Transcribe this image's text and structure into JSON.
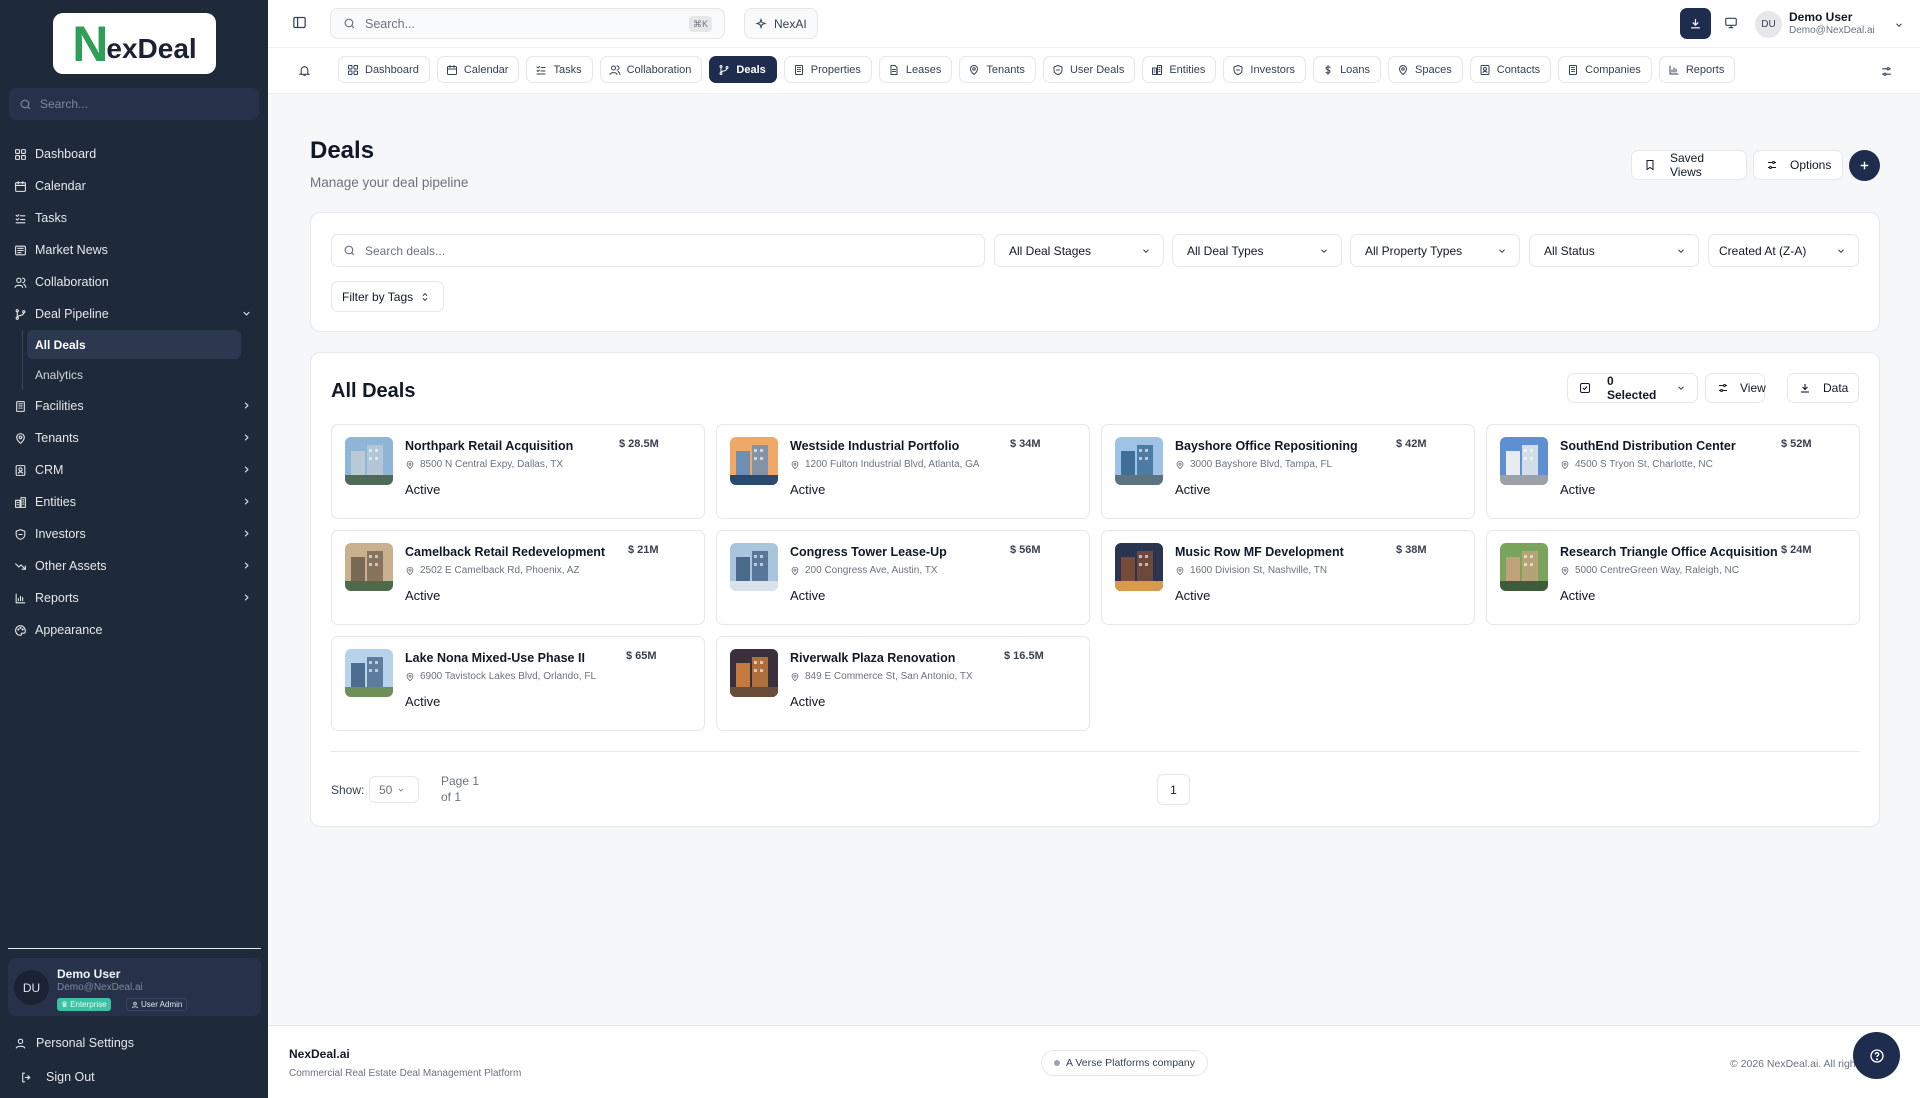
{
  "brand": {
    "logo_n": "N",
    "logo_rest": "exDeal"
  },
  "sidebar": {
    "search_placeholder": "Search...",
    "items": [
      {
        "label": "Dashboard",
        "icon": "dashboard-icon"
      },
      {
        "label": "Calendar",
        "icon": "calendar-icon"
      },
      {
        "label": "Tasks",
        "icon": "tasks-icon"
      },
      {
        "label": "Market News",
        "icon": "news-icon"
      },
      {
        "label": "Collaboration",
        "icon": "users-icon"
      },
      {
        "label": "Deal Pipeline",
        "icon": "pipeline-icon",
        "expanded": true
      },
      {
        "label": "Facilities",
        "icon": "building-icon"
      },
      {
        "label": "Tenants",
        "icon": "map-pin-icon"
      },
      {
        "label": "CRM",
        "icon": "crm-icon"
      },
      {
        "label": "Entities",
        "icon": "entities-icon"
      },
      {
        "label": "Investors",
        "icon": "shield-icon"
      },
      {
        "label": "Other Assets",
        "icon": "trend-icon"
      },
      {
        "label": "Reports",
        "icon": "chart-icon"
      },
      {
        "label": "Appearance",
        "icon": "palette-icon"
      }
    ],
    "sub_items": [
      {
        "label": "All Deals",
        "active": true
      },
      {
        "label": "Analytics",
        "active": false
      }
    ],
    "user": {
      "initials": "DU",
      "name": "Demo User",
      "email": "Demo@NexDeal.ai",
      "badge_plan": "Enterprise",
      "badge_role": "User Admin"
    },
    "personal_settings": "Personal Settings",
    "sign_out": "Sign Out"
  },
  "topbar": {
    "search_placeholder": "Search...",
    "shortcut": "⌘K",
    "ai_label": "NexAI",
    "user": {
      "initials": "DU",
      "name": "Demo User",
      "email": "Demo@NexDeal.ai"
    }
  },
  "tabs": [
    {
      "label": "Dashboard",
      "icon": "dashboard-icon"
    },
    {
      "label": "Calendar",
      "icon": "calendar-icon"
    },
    {
      "label": "Tasks",
      "icon": "tasks-icon"
    },
    {
      "label": "Collaboration",
      "icon": "users-icon"
    },
    {
      "label": "Deals",
      "icon": "pipeline-icon",
      "active": true
    },
    {
      "label": "Properties",
      "icon": "building-icon"
    },
    {
      "label": "Leases",
      "icon": "document-icon"
    },
    {
      "label": "Tenants",
      "icon": "map-pin-icon"
    },
    {
      "label": "User Deals",
      "icon": "shield-icon"
    },
    {
      "label": "Entities",
      "icon": "entities-icon"
    },
    {
      "label": "Investors",
      "icon": "shield-icon"
    },
    {
      "label": "Loans",
      "icon": "dollar-icon"
    },
    {
      "label": "Spaces",
      "icon": "map-pin-icon"
    },
    {
      "label": "Contacts",
      "icon": "contact-icon"
    },
    {
      "label": "Companies",
      "icon": "building-icon"
    },
    {
      "label": "Reports",
      "icon": "chart-icon"
    }
  ],
  "page": {
    "title": "Deals",
    "subtitle": "Manage your deal pipeline",
    "saved_views": "Saved Views",
    "options": "Options"
  },
  "filters": {
    "search_placeholder": "Search deals...",
    "selects": [
      "All Deal Stages",
      "All Deal Types",
      "All Property Types",
      "All Status",
      "Created At (Z-A)"
    ],
    "tags": "Filter by Tags"
  },
  "deals": {
    "title": "All Deals",
    "selected": "0 Selected",
    "view": "View",
    "data": "Data",
    "cards": [
      {
        "name": "Northpark Retail Acquisition",
        "value": "$ 28.5M",
        "address": "8500 N Central Expy, Dallas, TX",
        "status": "Active",
        "palette": [
          "#8fb5d8",
          "#b9c9d6",
          "#4f6b57"
        ]
      },
      {
        "name": "Westside Industrial Portfolio",
        "value": "$ 34M",
        "address": "1200 Fulton Industrial Blvd, Atlanta, GA",
        "status": "Active",
        "palette": [
          "#f0a867",
          "#6e8fb3",
          "#2c4a6e"
        ]
      },
      {
        "name": "Bayshore Office Repositioning",
        "value": "$ 42M",
        "address": "3000 Bayshore Blvd, Tampa, FL",
        "status": "Active",
        "palette": [
          "#9ec3e6",
          "#3f6f96",
          "#5c7480"
        ]
      },
      {
        "name": "SouthEnd Distribution Center",
        "value": "$ 52M",
        "address": "4500 S Tryon St, Charlotte, NC",
        "status": "Active",
        "palette": [
          "#5e8fd1",
          "#e8ebef",
          "#9aa1a8"
        ]
      },
      {
        "name": "Camelback Retail Redevelopment",
        "value": "$ 21M",
        "address": "2502 E Camelback Rd, Phoenix, AZ",
        "status": "Active",
        "palette": [
          "#c9b18f",
          "#7a6a55",
          "#4d6b4a"
        ]
      },
      {
        "name": "Congress Tower Lease-Up",
        "value": "$ 56M",
        "address": "200 Congress Ave, Austin, TX",
        "status": "Active",
        "palette": [
          "#a9c4dd",
          "#4a6a8c",
          "#d9e2ea"
        ]
      },
      {
        "name": "Music Row MF Development",
        "value": "$ 38M",
        "address": "1600 Division St, Nashville, TN",
        "status": "Active",
        "palette": [
          "#2b3550",
          "#7b4b3a",
          "#d99a4e"
        ]
      },
      {
        "name": "Research Triangle Office Acquisition",
        "value": "$ 24M",
        "address": "5000 CentreGreen Way, Raleigh, NC",
        "status": "Active",
        "palette": [
          "#7aa35c",
          "#bfa27a",
          "#3d5c3a"
        ]
      },
      {
        "name": "Lake Nona Mixed-Use Phase II",
        "value": "$ 65M",
        "address": "6900 Tavistock Lakes Blvd, Orlando, FL",
        "status": "Active",
        "palette": [
          "#b7d3ec",
          "#4c6d8f",
          "#6f8f5a"
        ]
      },
      {
        "name": "Riverwalk Plaza Renovation",
        "value": "$ 16.5M",
        "address": "849 E Commerce St, San Antonio, TX",
        "status": "Active",
        "palette": [
          "#3a2f3d",
          "#c47a3c",
          "#6a4b3a"
        ]
      }
    ]
  },
  "pagination": {
    "show_label": "Show:",
    "page_size": "50",
    "page_text": "Page 1 of 1",
    "current": "1"
  },
  "footer": {
    "brand": "NexDeal.ai",
    "tagline": "Commercial Real Estate Deal Management Platform",
    "company": "A Verse Platforms company",
    "copyright": "© 2026 NexDeal.ai. All rights"
  }
}
